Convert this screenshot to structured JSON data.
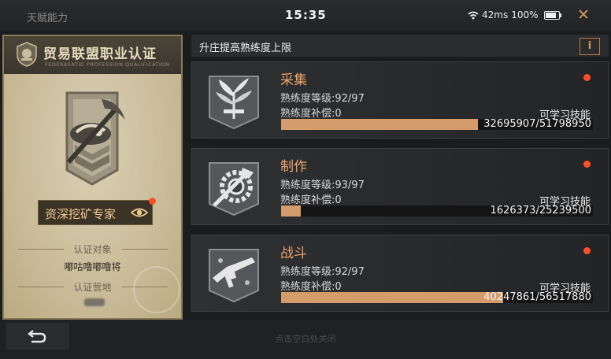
{
  "status_bar": {
    "app_title": "天赋能力",
    "time": "15:35",
    "latency": "42ms",
    "battery": "100%"
  },
  "certificate": {
    "title": "贸易联盟职业认证",
    "subtitle": "FEDERASATIO PROFESSION QUALIFICATION",
    "rank": "资深挖矿专家",
    "target_label": "认证对象",
    "target_name": "嘟咕噜嘟噜将",
    "camp_label": "认证营地"
  },
  "panel": {
    "title": "升庄提高熟练度上限",
    "info_label": "i"
  },
  "skills": [
    {
      "name": "采集",
      "level": "熟练度等级:92/97",
      "compensation": "熟练度补偿:0",
      "learnable": "可学习技能",
      "progress_text": "32695907/51798950",
      "progress": 0.631,
      "icon": "gathering-icon"
    },
    {
      "name": "制作",
      "level": "熟练度等级:93/97",
      "compensation": "熟练度补偿:0",
      "learnable": "可学习技能",
      "progress_text": "1626373/25239500",
      "progress": 0.064,
      "icon": "crafting-icon"
    },
    {
      "name": "战斗",
      "level": "熟练度等级:92/97",
      "compensation": "熟练度补偿:0",
      "learnable": "可学习技能",
      "progress_text": "40247861/56517880",
      "progress": 0.712,
      "icon": "combat-icon"
    }
  ],
  "footer": {
    "hint": "点击空白处关闭"
  },
  "colors": {
    "accent": "#eea46b",
    "progress": "#d49c6b",
    "notify_dot": "#ff4f2a"
  }
}
